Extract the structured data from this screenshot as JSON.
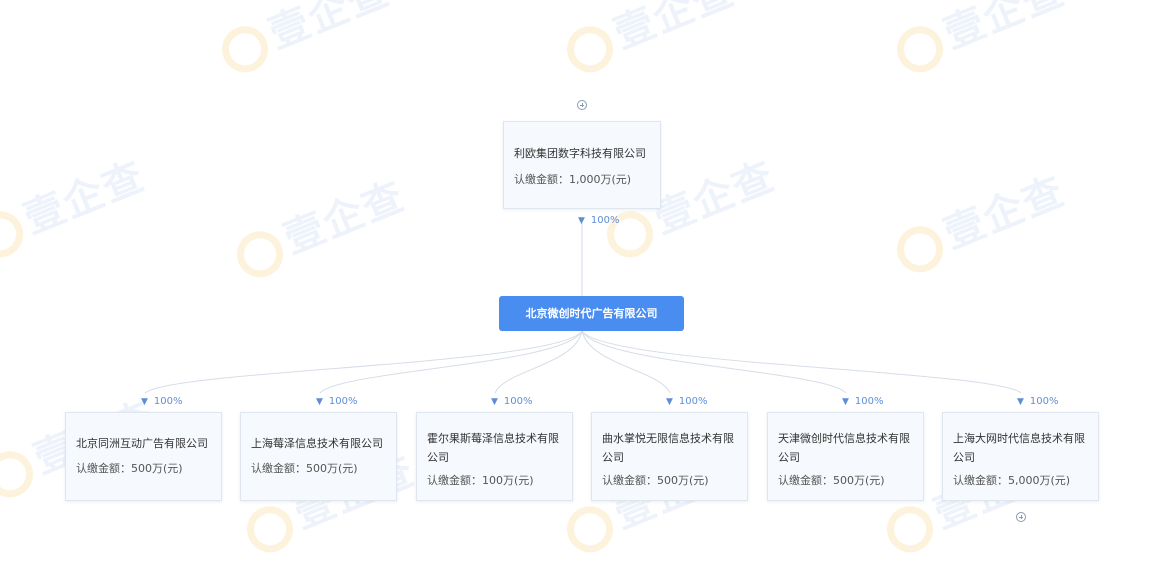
{
  "watermark": {
    "text": "壹企查"
  },
  "parent": {
    "name": "利欧集团数字科技有限公司",
    "amount_label": "认缴金额：",
    "amount": "1,000万(元)",
    "percent": "100%"
  },
  "center": {
    "name": "北京微创时代广告有限公司"
  },
  "children": [
    {
      "name": "北京同洲互动广告有限公司",
      "amount_label": "认缴金额：",
      "amount": "500万(元)",
      "percent": "100%"
    },
    {
      "name": "上海莓泽信息技术有限公司",
      "amount_label": "认缴金额：",
      "amount": "500万(元)",
      "percent": "100%"
    },
    {
      "name": "霍尔果斯莓泽信息技术有限公司",
      "amount_label": "认缴金额：",
      "amount": "100万(元)",
      "percent": "100%"
    },
    {
      "name": "曲水掌悦无限信息技术有限公司",
      "amount_label": "认缴金额：",
      "amount": "500万(元)",
      "percent": "100%"
    },
    {
      "name": "天津微创时代信息技术有限公司",
      "amount_label": "认缴金额：",
      "amount": "500万(元)",
      "percent": "100%"
    },
    {
      "name": "上海大网时代信息技术有限公司",
      "amount_label": "认缴金额：",
      "amount": "5,000万(元)",
      "percent": "100%"
    }
  ],
  "colors": {
    "center_bg": "#4a8df0",
    "percent_text": "#5f8ed6",
    "node_bg": "#f6f9fd",
    "node_border": "#dfe6ef",
    "link": "#d6dde8"
  }
}
